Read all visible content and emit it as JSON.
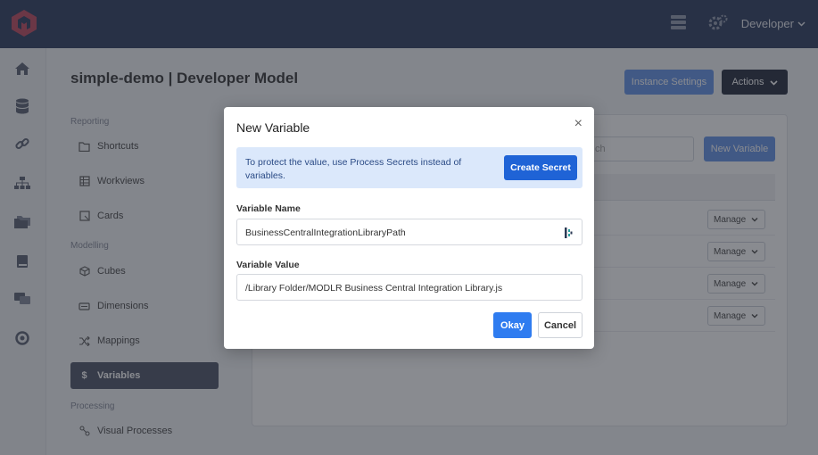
{
  "topbar": {
    "user_label": "Developer",
    "icons": [
      "logo-icon",
      "server-icon",
      "gears-icon",
      "chevron-down-icon"
    ]
  },
  "leftrail": {
    "icons": [
      "home-icon",
      "database-icon",
      "link-icon",
      "sitemap-icon",
      "folders-icon",
      "book-icon",
      "chat-icon",
      "help-icon"
    ]
  },
  "header": {
    "title": "simple-demo | Developer Model",
    "instance_settings_label": "Instance Settings",
    "actions_label": "Actions"
  },
  "sidebar": {
    "sections": [
      {
        "label": "Reporting"
      },
      {
        "label": "Modelling"
      },
      {
        "label": "Processing"
      }
    ],
    "items": [
      {
        "label": "Shortcuts",
        "icon": "folder-icon"
      },
      {
        "label": "Workviews",
        "icon": "grid-icon"
      },
      {
        "label": "Cards",
        "icon": "card-icon"
      },
      {
        "label": "Cubes",
        "icon": "cube-icon"
      },
      {
        "label": "Dimensions",
        "icon": "dimension-icon"
      },
      {
        "label": "Mappings",
        "icon": "shuffle-icon"
      },
      {
        "label": "Variables",
        "icon": "dollar-icon",
        "active": true
      },
      {
        "label": "Visual Processes",
        "icon": "process-icon"
      }
    ]
  },
  "panel": {
    "search_placeholder": "Search",
    "search_visible_text": "ch",
    "new_variable_label": "New Variable",
    "manage_label": "Manage"
  },
  "modal": {
    "title": "New Variable",
    "close_symbol": "×",
    "alert_text": "To protect the value, use Process Secrets instead of variables.",
    "create_secret_label": "Create Secret",
    "variable_name_label": "Variable Name",
    "variable_name_value": "BusinessCentralIntegrationLibraryPath",
    "variable_value_label": "Variable Value",
    "variable_value_value": "/Library Folder/MODLR Business Central Integration Library.js",
    "okay_label": "Okay",
    "cancel_label": "Cancel"
  },
  "colors": {
    "topbar": "#3d4a6a",
    "accent": "#2f7cf0",
    "create_secret": "#1f63d6",
    "alert_bg": "#dbe8fb",
    "active_nav": "#5b6173"
  }
}
